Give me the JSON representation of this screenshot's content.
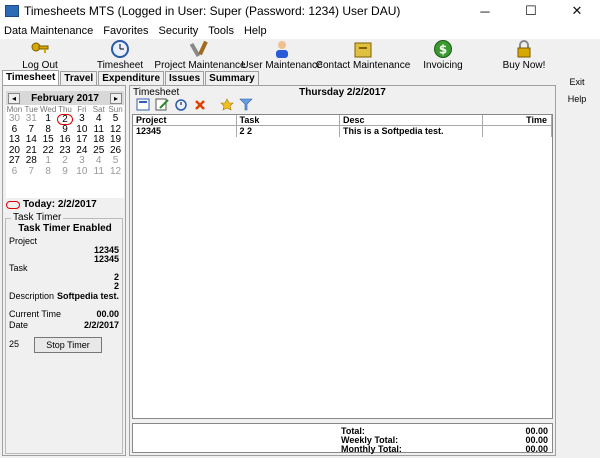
{
  "window": {
    "title": "Timesheets MTS (Logged in User: Super (Password: 1234) User DAU)",
    "controls": [
      "─",
      "☐",
      "✕"
    ]
  },
  "menu": [
    "Data Maintenance",
    "Favorites",
    "Security",
    "Tools",
    "Help"
  ],
  "toolbar": [
    {
      "label": "Log Out",
      "icon": "key-icon"
    },
    {
      "label": "Timesheet",
      "icon": "clock-icon"
    },
    {
      "label": "Project Maintenance",
      "icon": "tools-icon"
    },
    {
      "label": "User Maintenance",
      "icon": "user-icon"
    },
    {
      "label": "Contact Maintenance",
      "icon": "cabinet-icon"
    },
    {
      "label": "Invoicing",
      "icon": "dollar-icon"
    },
    {
      "label": "Buy Now!",
      "icon": "lock-icon"
    }
  ],
  "tabs": [
    "Timesheet",
    "Travel",
    "Expenditure",
    "Issues",
    "Summary"
  ],
  "calendar": {
    "month": "February 2017",
    "prev": "◂",
    "next": "▸",
    "dows": [
      "Mon",
      "Tue",
      "Wed",
      "Thu",
      "Fri",
      "Sat",
      "Sun"
    ],
    "days": [
      "30",
      "31",
      "1",
      "2",
      "3",
      "4",
      "5",
      "6",
      "7",
      "8",
      "9",
      "10",
      "11",
      "12",
      "13",
      "14",
      "15",
      "16",
      "17",
      "18",
      "19",
      "20",
      "21",
      "22",
      "23",
      "24",
      "25",
      "26",
      "27",
      "28",
      "1",
      "2",
      "3",
      "4",
      "5",
      "6",
      "7",
      "8",
      "9",
      "10",
      "11",
      "12"
    ],
    "today_label": "Today: 2/2/2017"
  },
  "task_timer": {
    "legend": "Task Timer",
    "status": "Task Timer Enabled",
    "project_label": "Project",
    "project_values": [
      "12345",
      "12345"
    ],
    "task_label": "Task",
    "task_values": [
      "2",
      "2"
    ],
    "description_label": "Description",
    "description_value": "Softpedia test.",
    "current_time_label": "Current Time",
    "current_time_value": "00.00",
    "date_label": "Date",
    "date_value": "2/2/2017",
    "counter": "25",
    "stop_button": "Stop Timer"
  },
  "timesheet": {
    "legend": "Timesheet",
    "date": "Thursday 2/2/2017",
    "columns": [
      "Project",
      "Task",
      "Desc",
      "Time"
    ],
    "rows": [
      {
        "project": "12345",
        "task": "2 2",
        "desc": "This is a Softpedia test.",
        "time": ""
      }
    ],
    "totals": [
      {
        "label": "Total:",
        "value": "00.00"
      },
      {
        "label": "Weekly Total:",
        "value": "00.00"
      },
      {
        "label": "Monthly Total:",
        "value": "00.00"
      }
    ]
  },
  "side_buttons": [
    "Exit",
    "Help"
  ]
}
